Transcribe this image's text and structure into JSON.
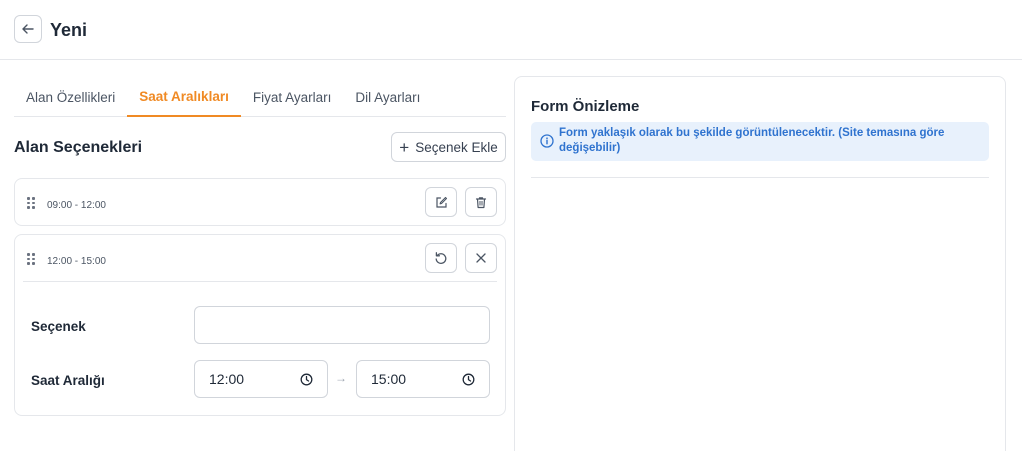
{
  "header": {
    "title": "Yeni",
    "back_icon": "arrow-left-icon"
  },
  "tabs": [
    {
      "label": "Alan Özellikleri",
      "active": false
    },
    {
      "label": "Saat Aralıkları",
      "active": true
    },
    {
      "label": "Fiyat Ayarları",
      "active": false
    },
    {
      "label": "Dil Ayarları",
      "active": false
    }
  ],
  "options_section": {
    "title": "Alan Seçenekleri",
    "add_label": "Seçenek Ekle"
  },
  "items": [
    {
      "time": "09:00 - 12:00",
      "actions": [
        "edit-icon",
        "trash-icon"
      ]
    },
    {
      "time": "12:00 - 15:00",
      "actions": [
        "undo-icon",
        "close-icon"
      ],
      "expanded": true,
      "option_label": "Seçenek",
      "option_value": "",
      "range_label": "Saat Aralığı",
      "start_time": "12:00",
      "end_time": "15:00",
      "range_separator": "→"
    }
  ],
  "preview": {
    "title": "Form Önizleme",
    "info": "Form yaklaşık olarak bu şekilde görüntülenecektir. (Site temasına göre değişebilir)"
  },
  "colors": {
    "accent": "#f08a24",
    "info_bg": "#e8f1fc",
    "info_text": "#2f73cf",
    "border": "#e5e7eb"
  }
}
